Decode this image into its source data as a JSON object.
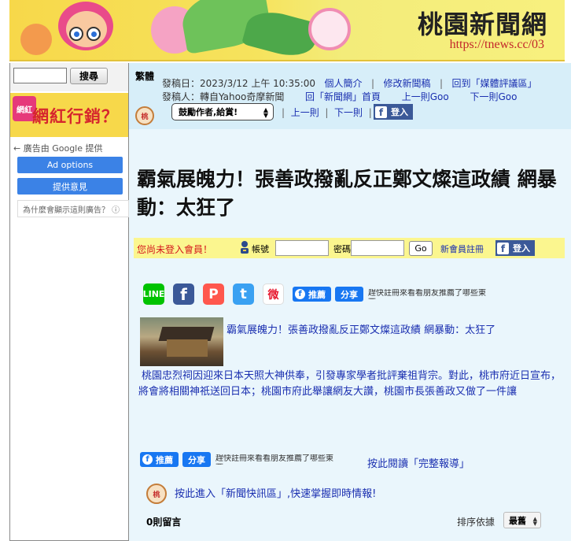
{
  "banner": {
    "site_title": "桃園新聞網",
    "site_url": "https://tnews.cc/03"
  },
  "sidebar": {
    "search_button": "搜尋",
    "ad_badge": "網\n紅",
    "ad_text": "網紅行銷？",
    "google_line": "← 廣告由 Google 提供",
    "ad_options": "Ad options",
    "feedback": "提供意見",
    "why_ad": "為什麼會顯示這則廣告？ ⓘ"
  },
  "info": {
    "trad_toggle": "繁體",
    "posted_label": "發稿日：2023/3/12 上午 10:35:00",
    "profile_link": "個人簡介",
    "edit_link": "修改新聞稿",
    "media_review_link": "回到「媒體評議區」",
    "poster_label": "發稿人：轉自Yahoo奇摩新聞",
    "home_link": "回「新聞網」首頁",
    "prev_goo_link": "上一則Goo",
    "next_goo_link": "下一則Goo",
    "avatar_text": "桃",
    "tip_select": "鼓勵作者,給賞!",
    "prev_link": "上一則",
    "next_link": "下一則",
    "fb_login": "登入",
    "separator": "|"
  },
  "headline": "霸氣展魄力！張善政撥亂反正鄭文燦這政績 網暴動：太狂了",
  "login_bar": {
    "notice": "您尚未登入會員！",
    "account_label": "帳號",
    "password_label": "密碼",
    "go_button": "Go",
    "register_link": "新會員註冊",
    "fb_login": "登入"
  },
  "share": {
    "line": "LINE",
    "facebook": "f",
    "plurk": "P",
    "twitter": "t",
    "weibo": "微",
    "fb_like": "推薦",
    "fb_share": "分享",
    "fb_hint": "趕快註冊來看看朋友推薦了哪些東西。"
  },
  "article": {
    "title": "霸氣展魄力！張善政撥亂反正鄭文燦這政績 網暴動：太狂了",
    "body": "桃園忠烈祠因迎來日本天照大神供奉，引發專家學者批評棄祖背宗。對此，桃市府近日宣布，將會將相關神祇送回日本；桃園市府此舉讓網友大讚，桃園市長張善政又做了一件讓",
    "full_report_link": "按此閱讀「完整報導」",
    "news_link": "按此進入「新聞快訊區」,快速掌握即時情報!",
    "news_avatar": "桃"
  },
  "comments": {
    "count": "0則留言",
    "sort_label": "排序依據",
    "sort_value": "最舊"
  },
  "colors": {
    "banner": "#f7d84a",
    "info_panel": "#d7eef9",
    "main_bg": "#eaf6fc",
    "link": "#1a2fb0",
    "notice": "#d4161b",
    "facebook": "#3b5998",
    "google_btn": "#3b82e6",
    "login_bar": "#fbf68f"
  },
  "icons": [
    "monkey-mascot-icon",
    "search-icon",
    "user-key-icon",
    "line-icon",
    "facebook-icon",
    "plurk-icon",
    "twitter-icon",
    "weibo-icon",
    "dropdown-arrow-icon"
  ]
}
